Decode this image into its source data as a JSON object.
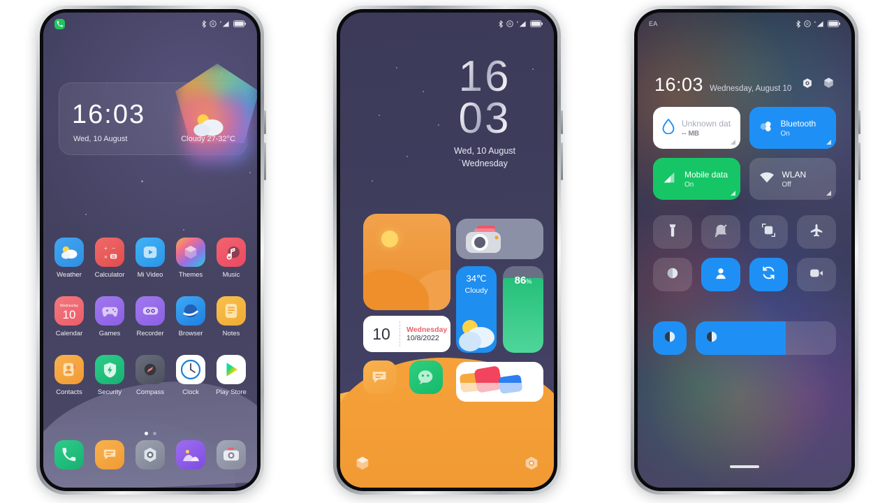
{
  "phone1": {
    "name": "home-screen",
    "statusbar": {
      "notification_icon": "phone-call-icon",
      "icons": [
        "bluetooth-icon",
        "dnd-icon",
        "signal-e-icon",
        "battery-icon"
      ]
    },
    "clock_widget": {
      "time": "16:03",
      "date": "Wed, 10 August",
      "weather": "Cloudy  27-32°C",
      "weather_icon": "sun-cloud-icon"
    },
    "apps": [
      {
        "label": "Weather",
        "icon": "weather-icon"
      },
      {
        "label": "Calculator",
        "icon": "calculator-icon"
      },
      {
        "label": "Mi Video",
        "icon": "mi-video-icon"
      },
      {
        "label": "Themes",
        "icon": "themes-icon"
      },
      {
        "label": "Music",
        "icon": "music-icon"
      },
      {
        "label": "Calendar",
        "icon": "calendar-icon"
      },
      {
        "label": "Games",
        "icon": "games-icon"
      },
      {
        "label": "Recorder",
        "icon": "recorder-icon"
      },
      {
        "label": "Browser",
        "icon": "browser-icon"
      },
      {
        "label": "Notes",
        "icon": "notes-icon"
      },
      {
        "label": "Contacts",
        "icon": "contacts-icon"
      },
      {
        "label": "Security",
        "icon": "security-icon"
      },
      {
        "label": "Compass",
        "icon": "compass-icon"
      },
      {
        "label": "Clock",
        "icon": "clock-icon"
      },
      {
        "label": "Play Store",
        "icon": "play-store-icon"
      }
    ],
    "calendar_icon_day": "10",
    "calendar_icon_dow": "Wednesday",
    "page_dots": {
      "count": 2,
      "active": 1
    },
    "dock": [
      {
        "icon": "phone-icon"
      },
      {
        "icon": "messages-icon"
      },
      {
        "icon": "settings-icon"
      },
      {
        "icon": "gallery-icon"
      },
      {
        "icon": "camera-icon"
      }
    ]
  },
  "phone2": {
    "name": "widget-home-screen",
    "statusbar": {
      "icons": [
        "bluetooth-icon",
        "dnd-icon",
        "signal-e-icon",
        "battery-icon"
      ]
    },
    "clock": {
      "hours": "16",
      "minutes": "03",
      "date": "Wed, 10 August",
      "weekday": "Wednesday"
    },
    "widgets": {
      "photo": {
        "name": "desert-photo-widget"
      },
      "camera": {
        "name": "camera-widget"
      },
      "calendar": {
        "day": "10",
        "weekday": "Wednesday",
        "date": "10/8/2022"
      },
      "weather": {
        "temp": "34℃",
        "condition": "Cloudy"
      },
      "battery": {
        "value": "86",
        "unit": "%",
        "level_percent": 86
      },
      "gallery": {
        "name": "gallery-widget"
      }
    },
    "apps": [
      {
        "icon": "messages-icon"
      },
      {
        "icon": "wechat-icon"
      }
    ],
    "dock": [
      {
        "icon": "themes-icon"
      },
      {
        "icon": "settings-icon"
      }
    ]
  },
  "phone3": {
    "name": "control-center",
    "statusbar": {
      "carrier": "EA",
      "icons": [
        "bluetooth-icon",
        "dnd-icon",
        "signal-e-icon",
        "battery-icon"
      ]
    },
    "header": {
      "time": "16:03",
      "date": "Wednesday, August 10",
      "actions": [
        {
          "icon": "settings-hex-icon"
        },
        {
          "icon": "edit-hex-icon"
        }
      ]
    },
    "tiles": [
      {
        "title": "Unknown data plan",
        "sub": "-- MB",
        "icon": "data-usage-icon",
        "state": "off",
        "style": "white"
      },
      {
        "title": "Bluetooth",
        "sub": "On",
        "icon": "bluetooth-icon",
        "state": "on",
        "style": "blue"
      },
      {
        "title": "Mobile data",
        "sub": "On",
        "icon": "mobile-data-icon",
        "state": "on",
        "style": "green"
      },
      {
        "title": "WLAN",
        "sub": "Off",
        "icon": "wifi-icon",
        "state": "off",
        "style": "grey"
      }
    ],
    "quick_toggles": [
      {
        "icon": "flashlight-icon",
        "state": "off"
      },
      {
        "icon": "silent-mode-icon",
        "state": "off"
      },
      {
        "icon": "screenshot-icon",
        "state": "off"
      },
      {
        "icon": "airplane-mode-icon",
        "state": "off"
      },
      {
        "icon": "dark-mode-icon",
        "state": "off"
      },
      {
        "icon": "user-profile-icon",
        "state": "on"
      },
      {
        "icon": "auto-rotate-icon",
        "state": "on"
      },
      {
        "icon": "screen-record-icon",
        "state": "off"
      }
    ],
    "brightness": {
      "toggle_icon": "brightness-icon",
      "slider_icon": "brightness-icon",
      "level_percent": 64
    }
  },
  "colors": {
    "accent_blue": "#1e90f5",
    "green": "#22c55e",
    "orange": "#f2a24c",
    "screen_bg": "#3f3e5c"
  }
}
